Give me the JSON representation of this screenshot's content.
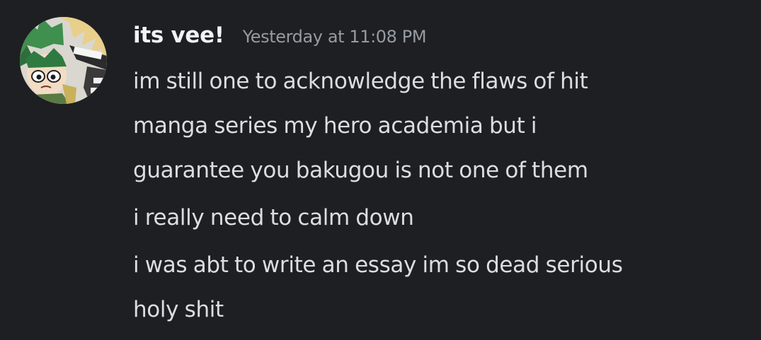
{
  "message_group": {
    "avatar_icon": "avatar-illustration-icon",
    "username": "its vee!",
    "timestamp": "Yesterday at 11:08 PM",
    "messages": [
      "im still one to acknowledge the flaws of hit\nmanga series my hero academia but i\nguarantee you bakugou is not one of them",
      "i really need to calm down",
      "i was abt to write an essay im so dead serious\nholy shit"
    ]
  },
  "colors": {
    "background": "#1e1f22",
    "username": "#f2f3f5",
    "timestamp": "#949ba4",
    "message_text": "#dbdee1"
  }
}
